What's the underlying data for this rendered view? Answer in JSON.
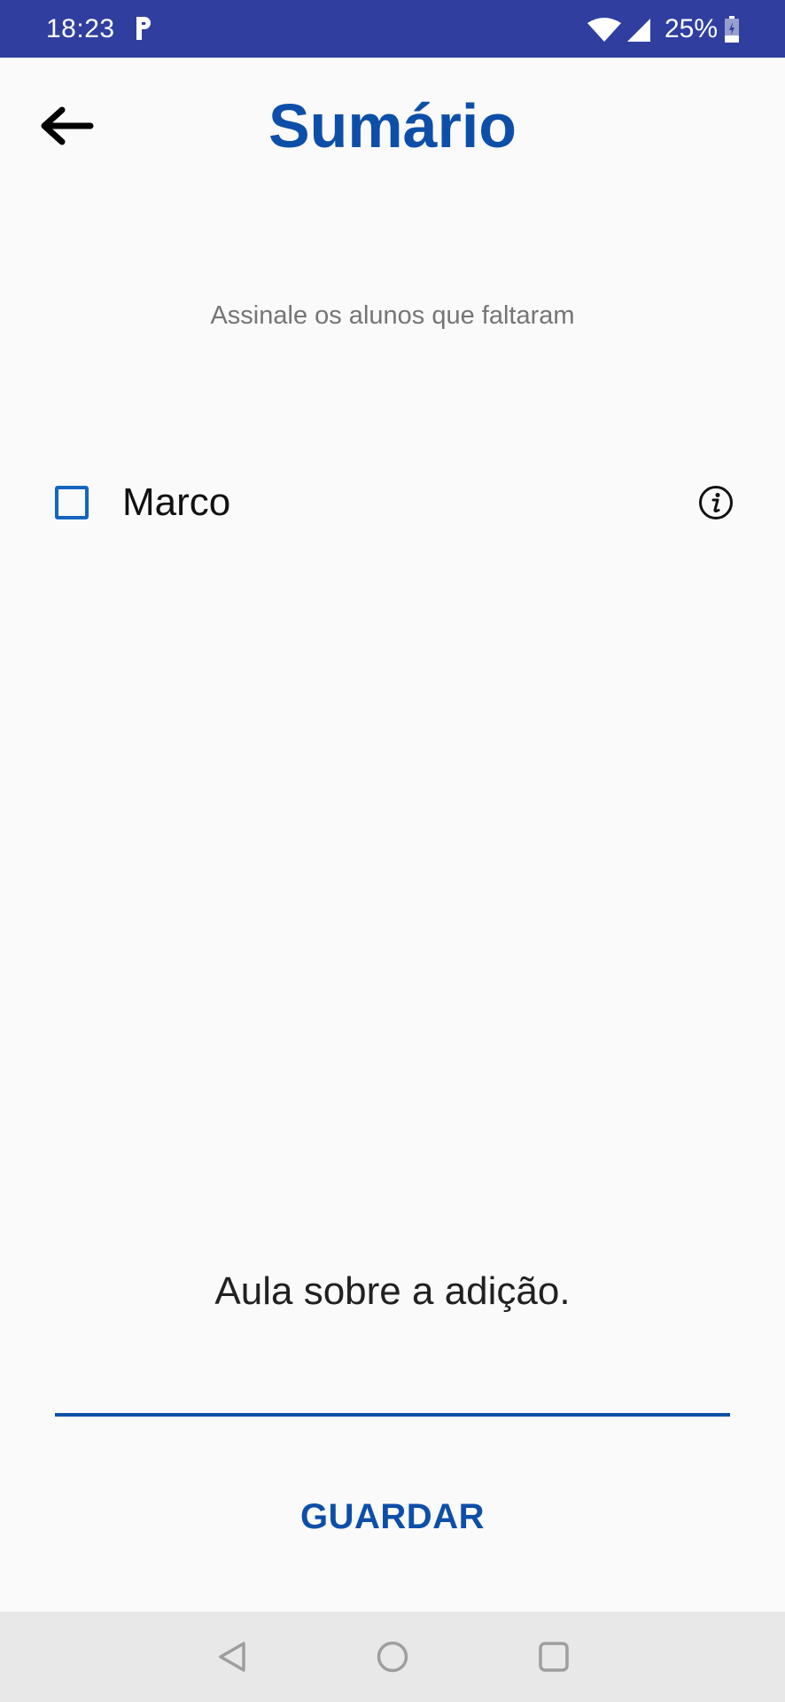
{
  "status_bar": {
    "time": "18:23",
    "battery_percent": "25%",
    "icons": [
      "parking-app-icon",
      "wifi-icon",
      "signal-icon",
      "battery-icon"
    ]
  },
  "header": {
    "title": "Sumário",
    "back_icon": "arrow-left-icon"
  },
  "instruction": "Assinale os alunos que faltaram",
  "students": [
    {
      "name": "Marco",
      "checked": false,
      "info_icon": "info-icon"
    }
  ],
  "summary_field": {
    "value": "Aula sobre a adição."
  },
  "actions": {
    "save_label": "GUARDAR"
  },
  "nav_bar": {
    "icons": [
      "back-triangle-icon",
      "home-circle-icon",
      "recents-square-icon"
    ]
  },
  "colors": {
    "status_bar": "#303f9f",
    "accent": "#0d4fa8",
    "background": "#fafafa",
    "nav_bar": "#e8e8e8"
  }
}
